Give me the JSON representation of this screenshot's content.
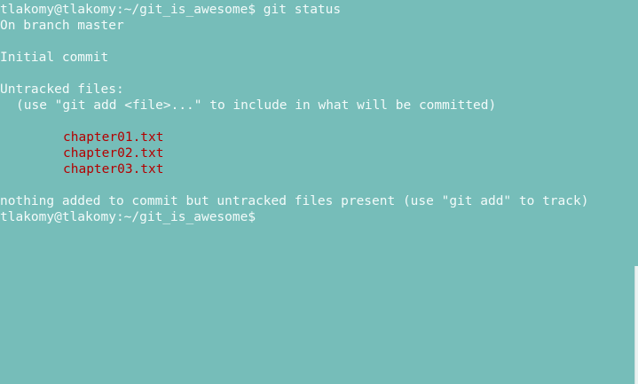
{
  "terminal": {
    "prompt_1": "tlakomy@tlakomy:~/git_is_awesome$ git status",
    "branch_line": "On branch master",
    "initial_commit": "Initial commit",
    "untracked_header": "Untracked files:",
    "untracked_hint": "(use \"git add <file>...\" to include in what will be committed)",
    "files": [
      "chapter01.txt",
      "chapter02.txt",
      "chapter03.txt"
    ],
    "summary": "nothing added to commit but untracked files present (use \"git add\" to track)",
    "prompt_2": "tlakomy@tlakomy:~/git_is_awesome$"
  },
  "colors": {
    "background": "#76bdb9",
    "text": "#f3fbfa",
    "untracked_file": "#b30000"
  }
}
